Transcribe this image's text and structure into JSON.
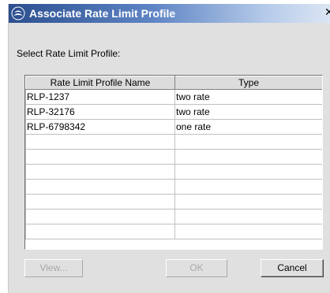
{
  "dialog": {
    "title": "Associate Rate Limit Profile",
    "close_glyph": "✕",
    "instruction": "Select Rate Limit Profile:"
  },
  "table": {
    "columns": [
      "Rate Limit Profile Name",
      "Type"
    ],
    "rows": [
      [
        "RLP-1237",
        "two rate"
      ],
      [
        "RLP-32176",
        "two rate"
      ],
      [
        "RLP-6798342",
        "one rate"
      ],
      [
        "",
        ""
      ],
      [
        "",
        ""
      ],
      [
        "",
        ""
      ],
      [
        "",
        ""
      ],
      [
        "",
        ""
      ],
      [
        "",
        ""
      ],
      [
        "",
        ""
      ]
    ]
  },
  "buttons": {
    "view": "View...",
    "ok": "OK",
    "cancel": "Cancel"
  },
  "icons": {
    "app": "java-cup-icon",
    "close": "close-icon"
  },
  "colors": {
    "titlebar_start": "#2b4f8f",
    "titlebar_end": "#dce6f4",
    "window_bg": "#e0e0e0"
  }
}
